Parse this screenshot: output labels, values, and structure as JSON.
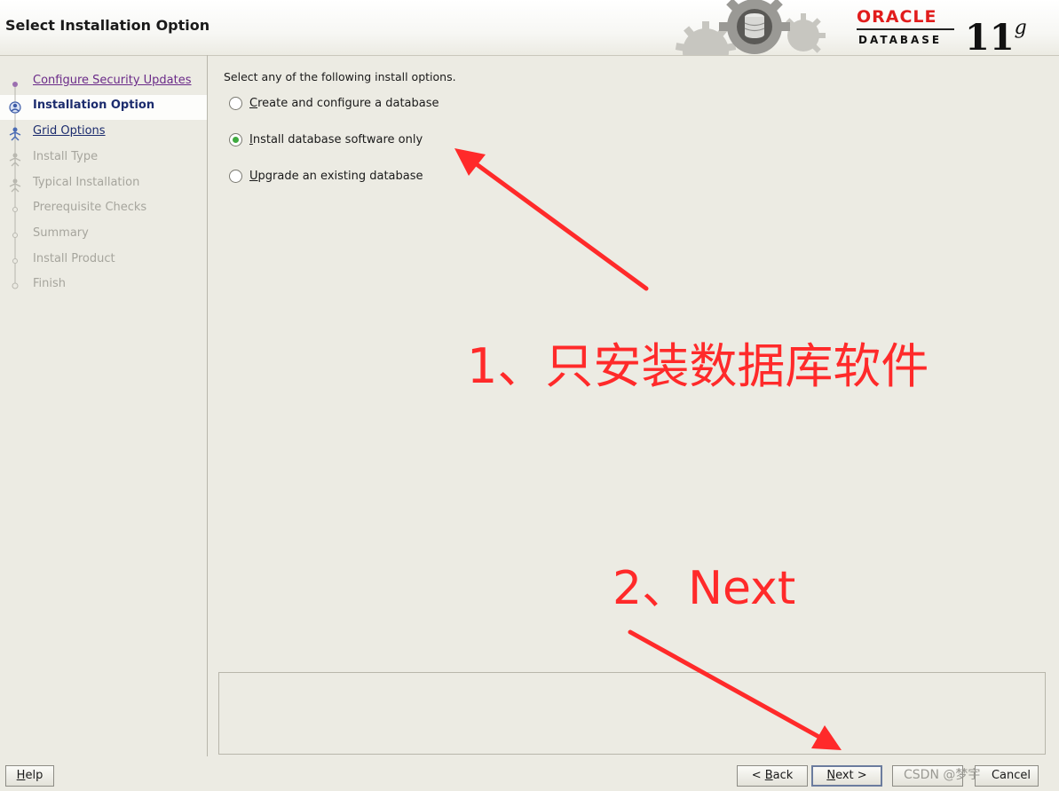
{
  "header": {
    "title": "Select Installation Option",
    "logo_brand": "ORACLE",
    "logo_product": "DATABASE",
    "logo_version": "11",
    "logo_version_suffix": "g"
  },
  "sidebar": {
    "steps": [
      {
        "label": "Configure Security Updates",
        "state": "visited"
      },
      {
        "label": "Installation Option",
        "state": "current"
      },
      {
        "label": "Grid Options",
        "state": "link"
      },
      {
        "label": "Install Type",
        "state": "disabled"
      },
      {
        "label": "Typical Installation",
        "state": "disabled"
      },
      {
        "label": "Prerequisite Checks",
        "state": "disabled"
      },
      {
        "label": "Summary",
        "state": "disabled"
      },
      {
        "label": "Install Product",
        "state": "disabled"
      },
      {
        "label": "Finish",
        "state": "disabled"
      }
    ]
  },
  "main": {
    "prompt": "Select any of the following install options.",
    "options": [
      {
        "mnemonic": "C",
        "rest": "reate and configure a database",
        "selected": false
      },
      {
        "mnemonic": "I",
        "rest": "nstall database software only",
        "selected": true
      },
      {
        "mnemonic": "U",
        "rest": "pgrade an existing database",
        "selected": false
      }
    ]
  },
  "buttons": {
    "help_mnemonic": "H",
    "help_rest": "elp",
    "back_prefix": "< ",
    "back_mnemonic": "B",
    "back_rest": "ack",
    "next_mnemonic": "N",
    "next_rest": "ext >",
    "cancel_label": "Cancel"
  },
  "annotations": {
    "step1": "1、只安装数据库软件",
    "step2": "2、Next",
    "color": "#ff2a2a"
  },
  "watermark": "CSDN @梦宇"
}
